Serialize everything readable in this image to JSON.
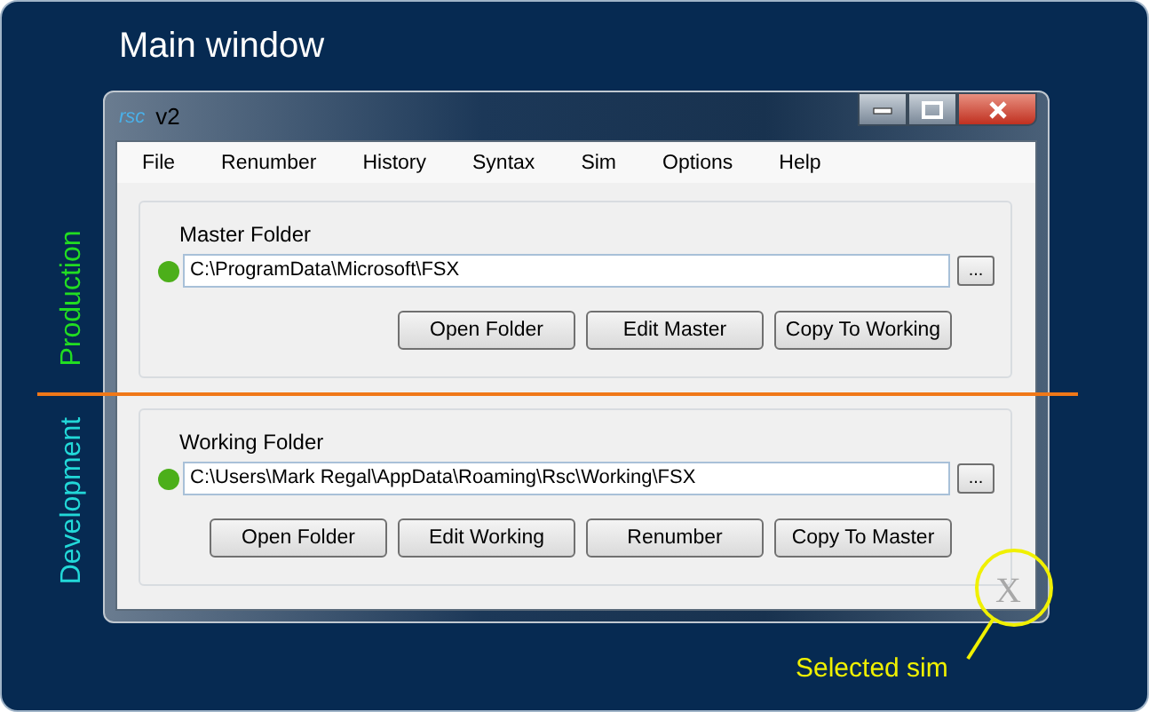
{
  "canvas_title": "Main window",
  "window": {
    "logo": "rsc",
    "title": "v2"
  },
  "menu": [
    "File",
    "Renumber",
    "History",
    "Syntax",
    "Sim",
    "Options",
    "Help"
  ],
  "folders": [
    {
      "label": "Master Folder",
      "color": "#4caf1a",
      "value": "C:\\ProgramData\\Microsoft\\FSX",
      "browse": "...",
      "buttons": [
        "Open Folder",
        "Edit Master",
        "Copy To Working"
      ]
    },
    {
      "label": "Working Folder",
      "color": "#4caf1a",
      "value": "C:\\Users\\Mark Regal\\AppData\\Roaming\\Rsc\\Working\\FSX",
      "browse": "...",
      "buttons": [
        "Open Folder",
        "Edit Working",
        "Renumber",
        "Copy To Master"
      ]
    }
  ],
  "sim_indicator": "X",
  "annotations": {
    "production": "Production",
    "development": "Development",
    "selected_sim": "Selected sim"
  }
}
